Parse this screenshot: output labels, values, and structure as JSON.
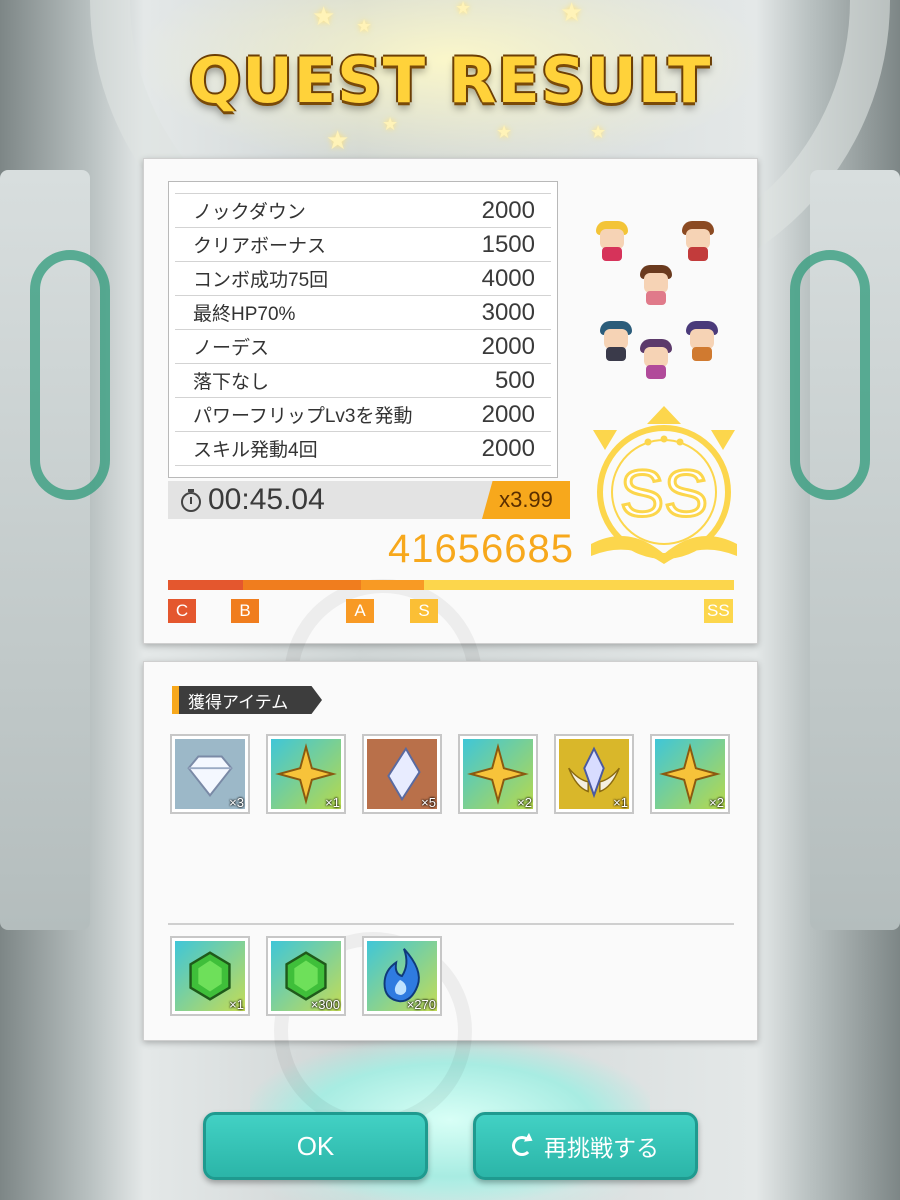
{
  "title": "QUEST RESULT",
  "score_items": [
    {
      "label": "ノックダウン",
      "points": "2000"
    },
    {
      "label": "クリアボーナス",
      "points": "1500"
    },
    {
      "label": "コンボ成功75回",
      "points": "4000"
    },
    {
      "label": "最終HP70%",
      "points": "3000"
    },
    {
      "label": "ノーデス",
      "points": "2000"
    },
    {
      "label": "落下なし",
      "points": "500"
    },
    {
      "label": "パワーフリップLv3を発動",
      "points": "2000"
    },
    {
      "label": "スキル発動4回",
      "points": "2000"
    }
  ],
  "timer": {
    "icon": "stopwatch-icon",
    "time": "00:45.04",
    "multiplier": "x3.99"
  },
  "total_score": "41656685",
  "rank": {
    "current": "SS",
    "levels": [
      "C",
      "B",
      "A",
      "S",
      "SS"
    ],
    "colors": {
      "C": "#e4572e",
      "B": "#f07d1e",
      "A": "#f89a24",
      "S": "#fbbf35",
      "SS": "#fcd64c"
    }
  },
  "items_section": {
    "label": "獲得アイテム",
    "rewards": [
      {
        "icon": "diamond-gem-icon",
        "qty": "×3"
      },
      {
        "icon": "gold-star-icon",
        "qty": "×1"
      },
      {
        "icon": "crystal-shard-icon",
        "qty": "×5"
      },
      {
        "icon": "gold-star-icon",
        "qty": "×2"
      },
      {
        "icon": "winged-crystal-icon",
        "qty": "×1"
      },
      {
        "icon": "gold-star-icon",
        "qty": "×2"
      }
    ],
    "bonus": [
      {
        "icon": "green-gem-icon",
        "qty": "×1"
      },
      {
        "icon": "green-gem-icon",
        "qty": "×300"
      },
      {
        "icon": "blue-flame-icon",
        "qty": "×270"
      }
    ]
  },
  "buttons": {
    "ok": "OK",
    "retry": "再挑戦する",
    "retry_icon": "retry-icon"
  },
  "accent": "#f7a81c",
  "button_color": "#34c3b6"
}
